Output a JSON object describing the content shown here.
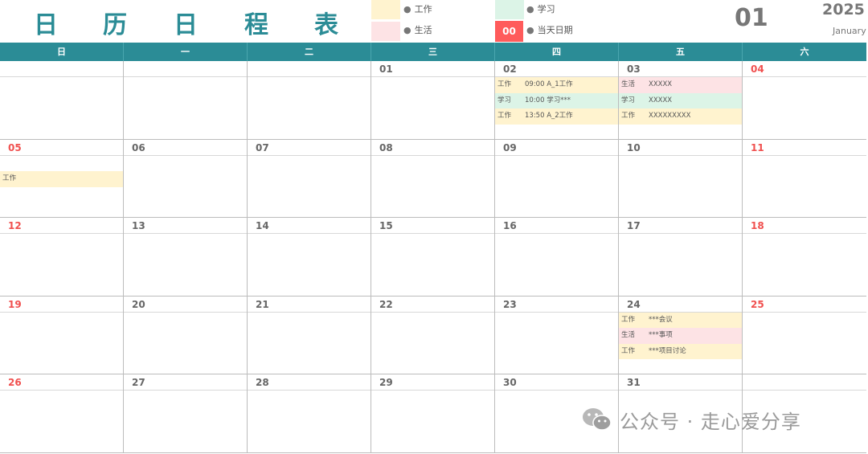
{
  "header": {
    "title_chars": [
      "日",
      "历",
      "日",
      "程",
      "表"
    ],
    "month": "01",
    "year": "2025",
    "month_name": "January"
  },
  "legend": [
    {
      "label": "工作",
      "color": "#fff3cf"
    },
    {
      "label": "生活",
      "color": "#fde3e5"
    },
    {
      "label": "学习",
      "color": "#dcf4e7"
    },
    {
      "label": "当天日期",
      "color": "#ff5b5b",
      "badge": "00"
    }
  ],
  "weekdays": [
    "日",
    "一",
    "二",
    "三",
    "四",
    "五",
    "六"
  ],
  "weeks": [
    [
      {
        "day": "",
        "weekend": true,
        "events": []
      },
      {
        "day": "",
        "events": []
      },
      {
        "day": "",
        "events": []
      },
      {
        "day": "01",
        "events": []
      },
      {
        "day": "02",
        "events": [
          {
            "cat": "工作",
            "type": "work",
            "text": "09:00 A_1工作"
          },
          {
            "cat": "学习",
            "type": "study",
            "text": "10:00  学习***"
          },
          {
            "cat": "工作",
            "type": "work",
            "text": "13:50 A_2工作"
          }
        ]
      },
      {
        "day": "03",
        "events": [
          {
            "cat": "生活",
            "type": "life",
            "text": "XXXXX"
          },
          {
            "cat": "学习",
            "type": "study",
            "text": "XXXXX"
          },
          {
            "cat": "工作",
            "type": "work",
            "text": "XXXXXXXXX"
          }
        ]
      },
      {
        "day": "04",
        "weekend": true,
        "events": []
      }
    ],
    [
      {
        "day": "05",
        "weekend": true,
        "events": [
          {
            "cat": "工作",
            "type": "work",
            "text": ""
          }
        ],
        "offset": 1
      },
      {
        "day": "06",
        "events": []
      },
      {
        "day": "07",
        "events": []
      },
      {
        "day": "08",
        "events": []
      },
      {
        "day": "09",
        "events": []
      },
      {
        "day": "10",
        "events": []
      },
      {
        "day": "11",
        "weekend": true,
        "events": []
      }
    ],
    [
      {
        "day": "12",
        "weekend": true,
        "events": []
      },
      {
        "day": "13",
        "events": []
      },
      {
        "day": "14",
        "events": []
      },
      {
        "day": "15",
        "events": []
      },
      {
        "day": "16",
        "events": []
      },
      {
        "day": "17",
        "events": []
      },
      {
        "day": "18",
        "weekend": true,
        "events": []
      }
    ],
    [
      {
        "day": "19",
        "weekend": true,
        "events": []
      },
      {
        "day": "20",
        "events": []
      },
      {
        "day": "21",
        "events": []
      },
      {
        "day": "22",
        "events": []
      },
      {
        "day": "23",
        "events": []
      },
      {
        "day": "24",
        "events": [
          {
            "cat": "工作",
            "type": "work",
            "text": "***会议"
          },
          {
            "cat": "生活",
            "type": "life",
            "text": "***事项"
          },
          {
            "cat": "工作",
            "type": "work",
            "text": "***项目讨论"
          }
        ]
      },
      {
        "day": "25",
        "weekend": true,
        "events": []
      }
    ],
    [
      {
        "day": "26",
        "weekend": true,
        "events": []
      },
      {
        "day": "27",
        "events": []
      },
      {
        "day": "28",
        "events": []
      },
      {
        "day": "29",
        "events": []
      },
      {
        "day": "30",
        "events": []
      },
      {
        "day": "31",
        "events": []
      },
      {
        "day": "",
        "weekend": true,
        "events": []
      }
    ]
  ],
  "watermark": {
    "text": "公众号 · 走心爱分享",
    "icon": "wechat-icon"
  }
}
